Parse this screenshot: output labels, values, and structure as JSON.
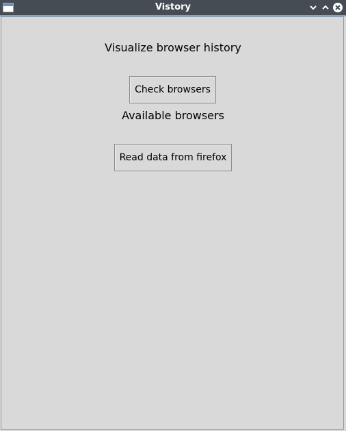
{
  "window": {
    "title": "Vistory",
    "controls": {
      "minimize_icon": "chevron-down-icon",
      "maximize_icon": "chevron-up-icon",
      "close_icon": "close-icon"
    }
  },
  "main": {
    "heading": "Visualize browser history",
    "check_button_label": "Check browsers",
    "available_label": "Available browsers",
    "read_button_label": "Read data from firefox"
  },
  "colors": {
    "titlebar_bg": "#464c53",
    "titlebar_accent": "#7aa6d6",
    "window_bg": "#d9d9d9"
  }
}
